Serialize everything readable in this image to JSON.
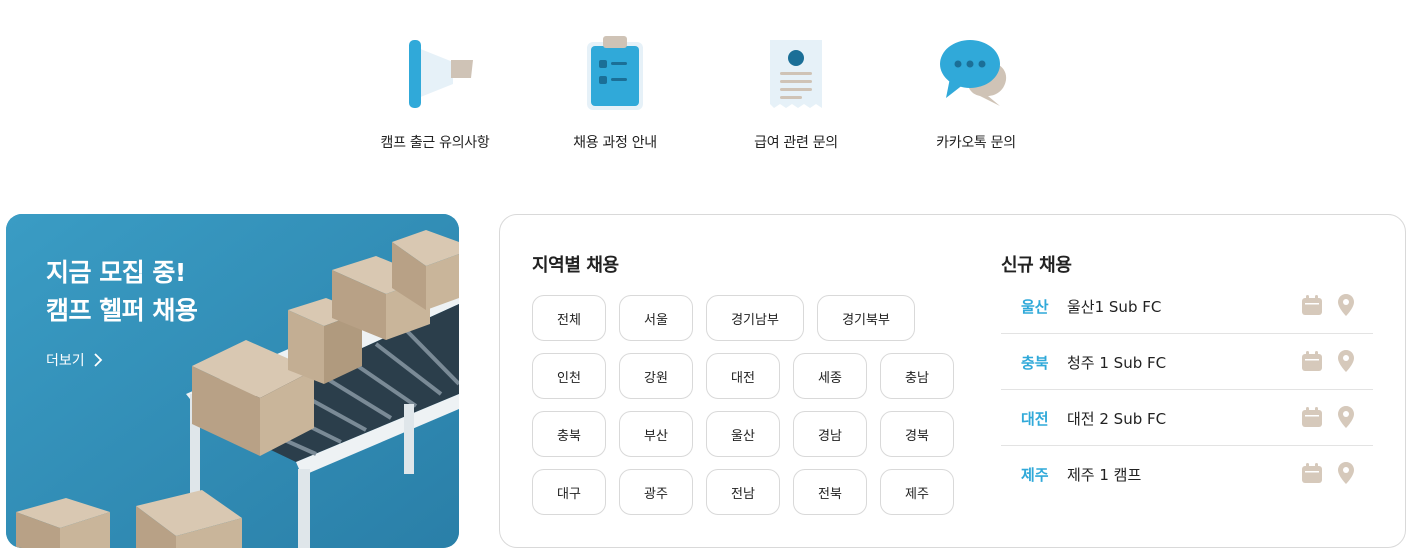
{
  "quick_links": [
    {
      "label": "캠프 출근 유의사항",
      "icon": "megaphone-icon"
    },
    {
      "label": "채용 과정 안내",
      "icon": "clipboard-checklist-icon"
    },
    {
      "label": "급여 관련 문의",
      "icon": "receipt-icon"
    },
    {
      "label": "카카오톡 문의",
      "icon": "chat-bubbles-icon"
    }
  ],
  "banner": {
    "title_line1": "지금 모집 중!",
    "title_line2": "캠프 헬퍼 채용",
    "more": "더보기"
  },
  "regional": {
    "title": "지역별 채용",
    "rows": [
      [
        "전체",
        "서울",
        "경기남부",
        "경기북부"
      ],
      [
        "인천",
        "강원",
        "대전",
        "세종",
        "충남"
      ],
      [
        "충북",
        "부산",
        "울산",
        "경남",
        "경북"
      ],
      [
        "대구",
        "광주",
        "전남",
        "전북",
        "제주"
      ]
    ]
  },
  "new_jobs": {
    "title": "신규 채용",
    "items": [
      {
        "region": "울산",
        "name": "울산1 Sub FC"
      },
      {
        "region": "충북",
        "name": "청주 1 Sub FC"
      },
      {
        "region": "대전",
        "name": "대전 2 Sub FC"
      },
      {
        "region": "제주",
        "name": "제주 1 캠프"
      }
    ]
  },
  "colors": {
    "accent": "#30a9d9",
    "beige": "#cfc3b6",
    "banner_bg": "#2f8fb8"
  }
}
